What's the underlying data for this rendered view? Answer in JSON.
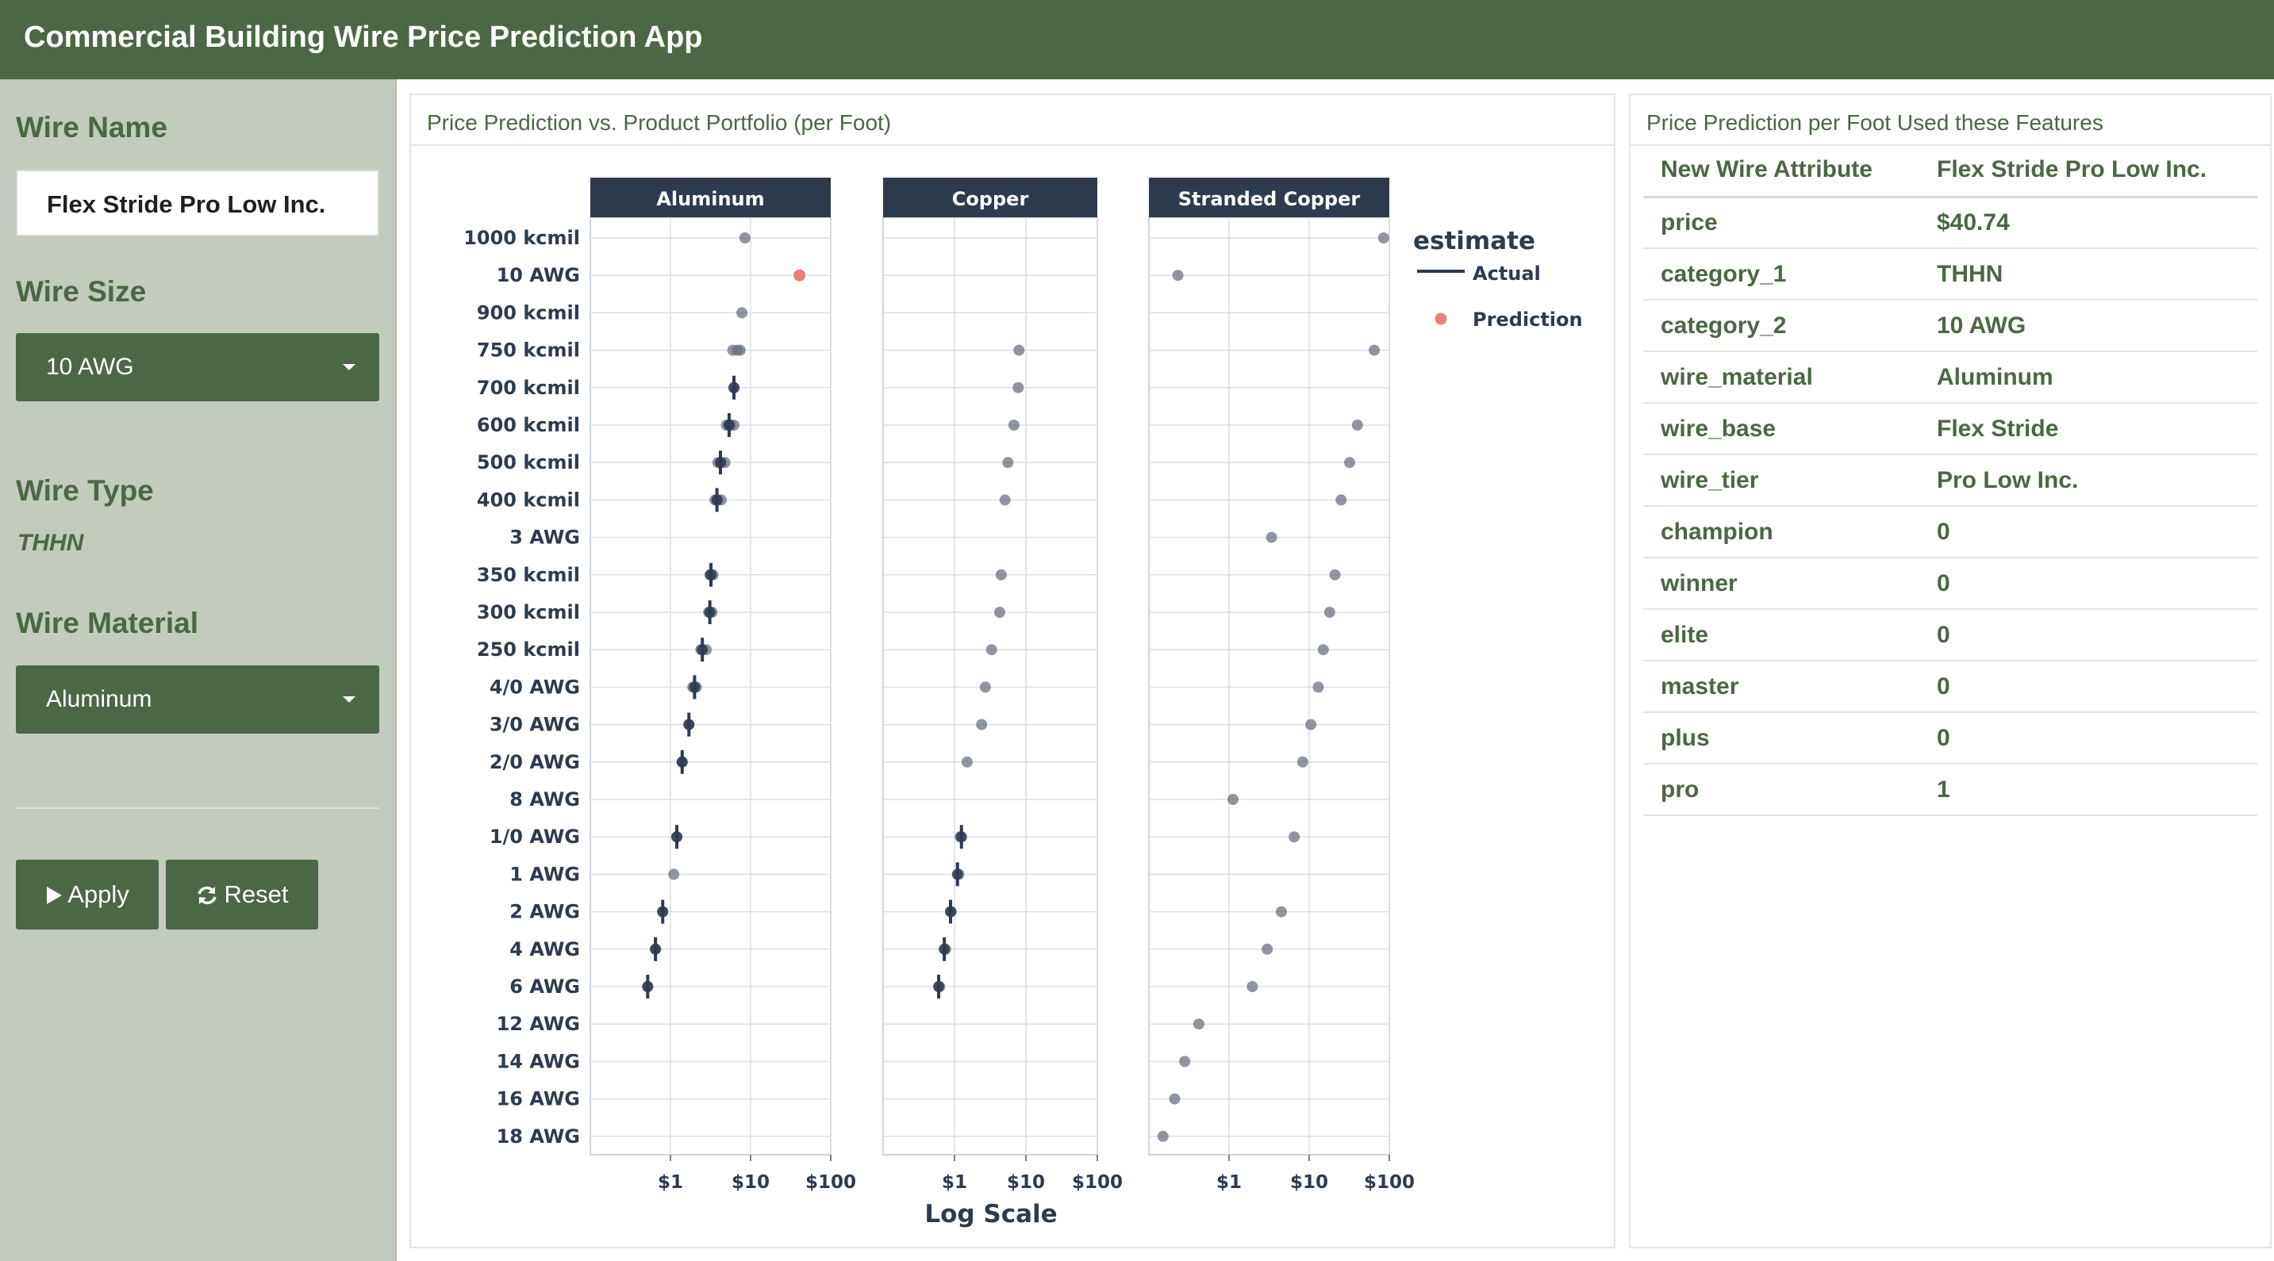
{
  "app": {
    "title": "Commercial Building Wire Price Prediction App"
  },
  "sidebar": {
    "wire_name_label": "Wire Name",
    "wire_name_value": "Flex Stride Pro Low Inc.",
    "wire_size_label": "Wire Size",
    "wire_size_value": "10 AWG",
    "wire_type_label": "Wire Type",
    "wire_type_value": "THHN",
    "wire_material_label": "Wire Material",
    "wire_material_value": "Aluminum",
    "apply_label": "Apply",
    "reset_label": "Reset"
  },
  "plot_card": {
    "title": "Price Prediction vs. Product Portfolio (per Foot)"
  },
  "features_card": {
    "title": "Price Prediction per Foot Used these Features",
    "header_attr": "New Wire Attribute",
    "header_value": "Flex Stride Pro Low Inc.",
    "rows": [
      {
        "attr": "price",
        "value": "$40.74"
      },
      {
        "attr": "category_1",
        "value": "THHN"
      },
      {
        "attr": "category_2",
        "value": "10 AWG"
      },
      {
        "attr": "wire_material",
        "value": "Aluminum"
      },
      {
        "attr": "wire_base",
        "value": "Flex Stride"
      },
      {
        "attr": "wire_tier",
        "value": "Pro Low Inc."
      },
      {
        "attr": "champion",
        "value": "0"
      },
      {
        "attr": "winner",
        "value": "0"
      },
      {
        "attr": "elite",
        "value": "0"
      },
      {
        "attr": "master",
        "value": "0"
      },
      {
        "attr": "plus",
        "value": "0"
      },
      {
        "attr": "pro",
        "value": "1"
      }
    ]
  },
  "icons": {
    "apply": "play-icon",
    "reset": "refresh-icon",
    "select": "caret-down-icon"
  },
  "colors": {
    "brand": "#4a6844",
    "sidebar": "#c2cbbd",
    "strip": "#2e3b4e",
    "actual": "#2e3b4e",
    "prediction": "#e8807a",
    "point": "#6b7280"
  },
  "chart_data": {
    "type": "scatter",
    "xlabel": "Log Scale",
    "x_scale": "log",
    "xlim": [
      0.1,
      100
    ],
    "x_ticks": [
      1,
      10,
      100
    ],
    "x_tick_labels": [
      "$1",
      "$10",
      "$100"
    ],
    "legend_title": "estimate",
    "legend": [
      "Actual",
      "Prediction"
    ],
    "legend_position": "right",
    "categories": [
      "1000 kcmil",
      "10 AWG",
      "900 kcmil",
      "750 kcmil",
      "700 kcmil",
      "600 kcmil",
      "500 kcmil",
      "400 kcmil",
      "3 AWG",
      "350 kcmil",
      "300 kcmil",
      "250 kcmil",
      "4/0 AWG",
      "3/0 AWG",
      "2/0 AWG",
      "8 AWG",
      "1/0 AWG",
      "1 AWG",
      "2 AWG",
      "4 AWG",
      "6 AWG",
      "12 AWG",
      "14 AWG",
      "16 AWG",
      "18 AWG"
    ],
    "panels": [
      {
        "name": "Aluminum",
        "points": [
          {
            "cat": "1000 kcmil",
            "x": 8.5
          },
          {
            "cat": "900 kcmil",
            "x": 7.8
          },
          {
            "cat": "750 kcmil",
            "x": 6.0
          },
          {
            "cat": "750 kcmil",
            "x": 6.8
          },
          {
            "cat": "750 kcmil",
            "x": 7.4
          },
          {
            "cat": "700 kcmil",
            "x": 6.2
          },
          {
            "cat": "600 kcmil",
            "x": 5.0
          },
          {
            "cat": "600 kcmil",
            "x": 5.6
          },
          {
            "cat": "600 kcmil",
            "x": 6.2
          },
          {
            "cat": "500 kcmil",
            "x": 3.9
          },
          {
            "cat": "500 kcmil",
            "x": 4.3
          },
          {
            "cat": "500 kcmil",
            "x": 4.8
          },
          {
            "cat": "400 kcmil",
            "x": 3.6
          },
          {
            "cat": "400 kcmil",
            "x": 3.9
          },
          {
            "cat": "400 kcmil",
            "x": 4.3
          },
          {
            "cat": "350 kcmil",
            "x": 3.1
          },
          {
            "cat": "350 kcmil",
            "x": 3.4
          },
          {
            "cat": "300 kcmil",
            "x": 3.0
          },
          {
            "cat": "300 kcmil",
            "x": 3.3
          },
          {
            "cat": "250 kcmil",
            "x": 2.4
          },
          {
            "cat": "250 kcmil",
            "x": 2.8
          },
          {
            "cat": "4/0 AWG",
            "x": 1.9
          },
          {
            "cat": "4/0 AWG",
            "x": 2.1
          },
          {
            "cat": "3/0 AWG",
            "x": 1.7
          },
          {
            "cat": "2/0 AWG",
            "x": 1.4
          },
          {
            "cat": "1/0 AWG",
            "x": 1.2
          },
          {
            "cat": "1 AWG",
            "x": 1.1
          },
          {
            "cat": "2 AWG",
            "x": 0.8
          },
          {
            "cat": "4 AWG",
            "x": 0.65
          },
          {
            "cat": "6 AWG",
            "x": 0.52
          }
        ],
        "actual": [
          {
            "cat": "700 kcmil",
            "x": 6.2
          },
          {
            "cat": "600 kcmil",
            "x": 5.4
          },
          {
            "cat": "500 kcmil",
            "x": 4.2
          },
          {
            "cat": "400 kcmil",
            "x": 3.8
          },
          {
            "cat": "350 kcmil",
            "x": 3.2
          },
          {
            "cat": "300 kcmil",
            "x": 3.1
          },
          {
            "cat": "250 kcmil",
            "x": 2.5
          },
          {
            "cat": "4/0 AWG",
            "x": 2.0
          },
          {
            "cat": "3/0 AWG",
            "x": 1.7
          },
          {
            "cat": "2/0 AWG",
            "x": 1.4
          },
          {
            "cat": "1/0 AWG",
            "x": 1.2
          },
          {
            "cat": "2 AWG",
            "x": 0.8
          },
          {
            "cat": "4 AWG",
            "x": 0.65
          },
          {
            "cat": "6 AWG",
            "x": 0.52
          }
        ],
        "prediction": [
          {
            "cat": "10 AWG",
            "x": 40.74
          }
        ]
      },
      {
        "name": "Copper",
        "points": [
          {
            "cat": "750 kcmil",
            "x": 8.0
          },
          {
            "cat": "700 kcmil",
            "x": 7.8
          },
          {
            "cat": "600 kcmil",
            "x": 6.8
          },
          {
            "cat": "500 kcmil",
            "x": 5.6
          },
          {
            "cat": "400 kcmil",
            "x": 5.1
          },
          {
            "cat": "350 kcmil",
            "x": 4.5
          },
          {
            "cat": "300 kcmil",
            "x": 4.3
          },
          {
            "cat": "250 kcmil",
            "x": 3.3
          },
          {
            "cat": "4/0 AWG",
            "x": 2.7
          },
          {
            "cat": "3/0 AWG",
            "x": 2.4
          },
          {
            "cat": "2/0 AWG",
            "x": 1.5
          },
          {
            "cat": "1/0 AWG",
            "x": 1.2
          },
          {
            "cat": "1 AWG",
            "x": 1.15
          },
          {
            "cat": "2 AWG",
            "x": 0.9
          },
          {
            "cat": "4 AWG",
            "x": 0.75
          },
          {
            "cat": "6 AWG",
            "x": 0.62
          }
        ],
        "actual": [
          {
            "cat": "1/0 AWG",
            "x": 1.25
          },
          {
            "cat": "1 AWG",
            "x": 1.1
          },
          {
            "cat": "2 AWG",
            "x": 0.88
          },
          {
            "cat": "4 AWG",
            "x": 0.72
          },
          {
            "cat": "6 AWG",
            "x": 0.6
          }
        ],
        "prediction": []
      },
      {
        "name": "Stranded Copper",
        "points": [
          {
            "cat": "1000 kcmil",
            "x": 85
          },
          {
            "cat": "10 AWG",
            "x": 0.23
          },
          {
            "cat": "750 kcmil",
            "x": 65
          },
          {
            "cat": "600 kcmil",
            "x": 40
          },
          {
            "cat": "500 kcmil",
            "x": 32
          },
          {
            "cat": "400 kcmil",
            "x": 25
          },
          {
            "cat": "3 AWG",
            "x": 3.4
          },
          {
            "cat": "350 kcmil",
            "x": 21
          },
          {
            "cat": "300 kcmil",
            "x": 18
          },
          {
            "cat": "250 kcmil",
            "x": 15
          },
          {
            "cat": "4/0 AWG",
            "x": 13
          },
          {
            "cat": "3/0 AWG",
            "x": 10.5
          },
          {
            "cat": "2/0 AWG",
            "x": 8.3
          },
          {
            "cat": "8 AWG",
            "x": 1.12
          },
          {
            "cat": "1/0 AWG",
            "x": 6.5
          },
          {
            "cat": "2 AWG",
            "x": 4.5
          },
          {
            "cat": "4 AWG",
            "x": 3.0
          },
          {
            "cat": "6 AWG",
            "x": 1.95
          },
          {
            "cat": "12 AWG",
            "x": 0.42
          },
          {
            "cat": "14 AWG",
            "x": 0.28
          },
          {
            "cat": "16 AWG",
            "x": 0.21
          },
          {
            "cat": "18 AWG",
            "x": 0.15
          }
        ],
        "actual": [],
        "prediction": []
      }
    ]
  }
}
